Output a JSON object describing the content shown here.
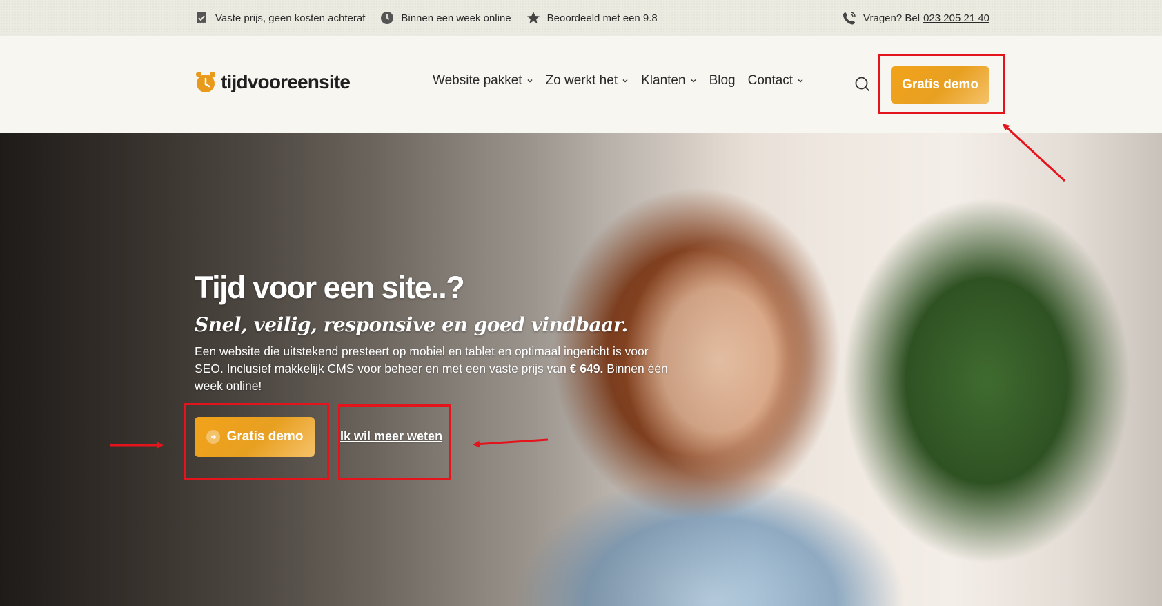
{
  "topbar": {
    "usps": [
      {
        "icon": "receipt-check-icon",
        "label": "Vaste prijs, geen kosten achteraf"
      },
      {
        "icon": "clock-icon",
        "label": "Binnen een week online"
      },
      {
        "icon": "star-icon",
        "label": "Beoordeeld met een 9.8"
      }
    ],
    "phone_prefix": "Vragen? Bel",
    "phone_number": "023 205 21 40"
  },
  "header": {
    "logo_text": "tijdvooreensite",
    "nav": [
      {
        "label": "Website pakket",
        "has_dropdown": true
      },
      {
        "label": "Zo werkt het",
        "has_dropdown": true
      },
      {
        "label": "Klanten",
        "has_dropdown": true
      },
      {
        "label": "Blog",
        "has_dropdown": false
      },
      {
        "label": "Contact",
        "has_dropdown": true
      }
    ],
    "cta_label": "Gratis demo"
  },
  "hero": {
    "title": "Tijd voor een site..?",
    "subtitle": "Snel, veilig, responsive en goed vindbaar.",
    "text_before": "Een website die uitstekend presteert op mobiel en tablet en optimaal ingericht is voor SEO. Inclusief makkelijk CMS voor beheer en met een vaste prijs van ",
    "price": "€ 649.",
    "text_after": " Binnen één week online!",
    "cta_label": "Gratis demo",
    "link_label": "Ik wil meer weten"
  },
  "colors": {
    "accent": "#EFA11D",
    "annotation": "#E3141B",
    "topbar_bg": "#ECEBE1",
    "header_bg": "#F7F6F1"
  }
}
